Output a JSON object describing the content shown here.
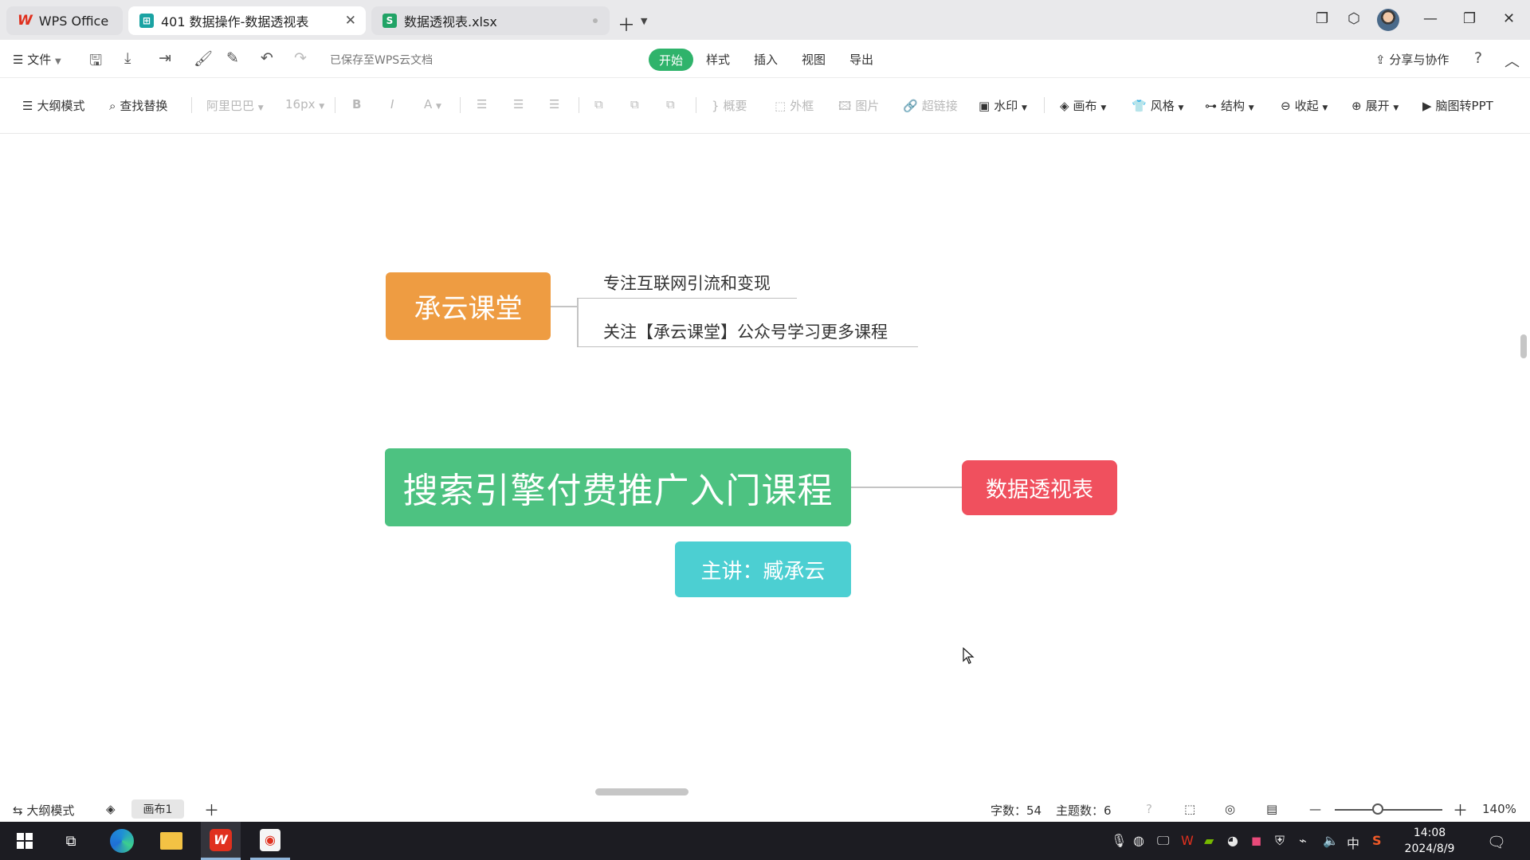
{
  "titlebar": {
    "tabs": [
      {
        "label": "WPS Office"
      },
      {
        "label": "401 数据操作-数据透视表"
      },
      {
        "label": "数据透视表.xlsx",
        "icon_letter": "S"
      }
    ]
  },
  "menubar": {
    "file_label": "文件",
    "saved_status": "已保存至WPS云文档",
    "tabs": [
      "开始",
      "样式",
      "插入",
      "视图",
      "导出"
    ],
    "share_label": "分享与协作"
  },
  "toolbar": {
    "outline_mode": "大纲模式",
    "find_replace": "查找替换",
    "font_name": "阿里巴巴",
    "font_size": "16px",
    "bold": "B",
    "italic": "I",
    "font_color": "A",
    "summary": "概要",
    "frame": "外框",
    "image": "图片",
    "hyperlink": "超链接",
    "watermark": "水印",
    "canvas": "画布",
    "style": "风格",
    "structure": "结构",
    "collapse": "收起",
    "expand": "展开",
    "to_ppt": "脑图转PPT"
  },
  "mindmap": {
    "brand_node": "承云课堂",
    "brand_children": [
      "专注互联网引流和变现",
      "关注【承云课堂】公众号学习更多课程"
    ],
    "root_node": "搜索引擎付费推广入门课程",
    "child_node": "数据透视表",
    "speaker_node": "主讲：臧承云"
  },
  "statusbar": {
    "outline_mode": "大纲模式",
    "canvas_tab": "画布1",
    "word_count": "字数：54",
    "topic_count": "主题数：6",
    "zoom": "140%",
    "zoom_fraction": 0.4
  },
  "taskbar": {
    "ime": "中",
    "time": "14:08",
    "date": "2024/8/9"
  },
  "colors": {
    "brand_node": "#ee9c42",
    "root_node": "#4dc281",
    "child_node": "#f0505e",
    "speaker_node": "#4ccfd2",
    "start_tab": "#2fb36b"
  }
}
